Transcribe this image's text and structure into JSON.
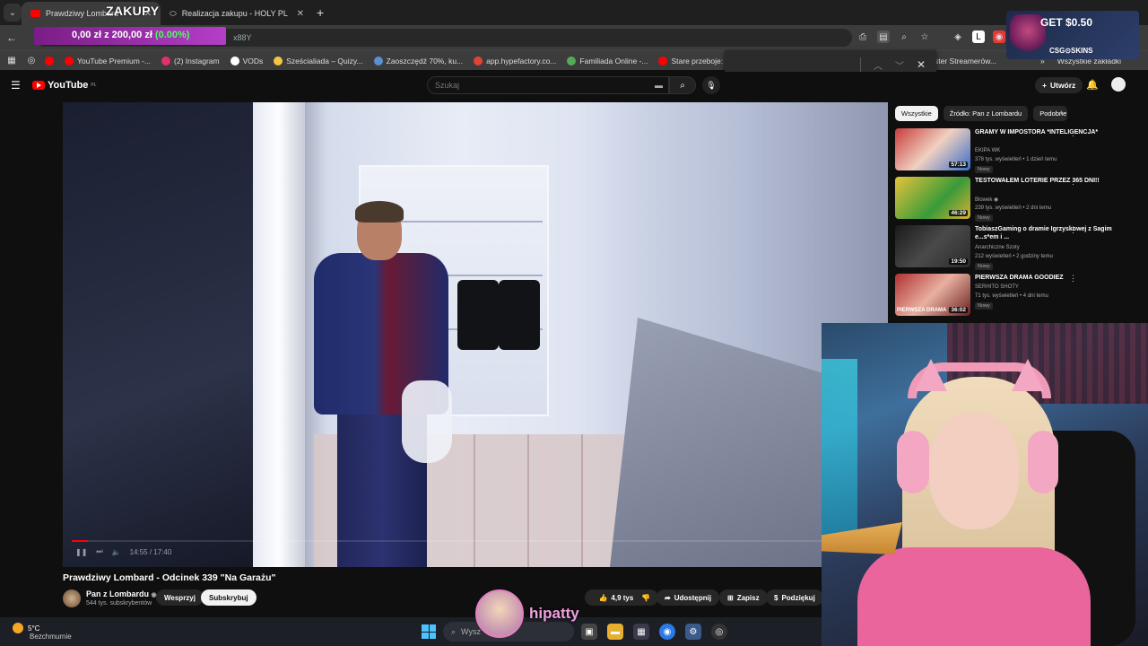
{
  "browser": {
    "tabs": [
      {
        "label": "Prawdziwy Lombard",
        "active": true
      },
      {
        "label": "Realizacja zakupu - HOLY PL",
        "active": false
      }
    ],
    "url_fragment": "x88Y",
    "bookmarks": [
      {
        "label": "YouTube Premium -...",
        "color": "#ff0000"
      },
      {
        "label": "(2) Instagram",
        "color": "#e1306c"
      },
      {
        "label": "VODs",
        "color": "#ffffff"
      },
      {
        "label": "Sześcialiada – Quizy...",
        "color": "#f5c542"
      },
      {
        "label": "Zaoszczędź 70%, ku...",
        "color": "#1b2838"
      },
      {
        "label": "app.hypefactory.co...",
        "color": "#e34234"
      },
      {
        "label": "Familiada Online -...",
        "color": "#55aa55"
      },
      {
        "label": "Stare przeboje: lege...",
        "color": "#ff0000"
      },
      {
        "label": "ster Streamerów...",
        "color": "#9146ff"
      },
      {
        "label": "Wszystkie zakładki",
        "color": "#888888"
      }
    ]
  },
  "overlay": {
    "zakupy_title": "ZAKUPY",
    "zakupy_amount": "0,00 zł z 200,00 zł",
    "zakupy_percent": "(0.00%)",
    "csgo_get": "GET $0.50",
    "csgo_brand": "CSG⊙SKINS",
    "streamer_name": "hipatty"
  },
  "youtube": {
    "logo": "YouTube",
    "region": "PL",
    "search_placeholder": "Szukaj",
    "create_label": "Utwórz",
    "video": {
      "title": "Prawdziwy Lombard - Odcinek 339 \"Na Garażu\"",
      "time": "14:55 / 17:40",
      "progress": 0.02
    },
    "channel": {
      "name": "Pan z Lombardu",
      "subscribers": "544 tys. subskrybentów",
      "support_label": "Wesprzyj",
      "subscribe_label": "Subskrybuj"
    },
    "actions": {
      "likes": "4,9 tys.",
      "share": "Udostępnij",
      "save": "Zapisz",
      "thanks": "Podziękuj"
    },
    "chips": [
      "Wszystkie",
      "Źródło: Pan z Lombardu",
      "Podobne"
    ],
    "recommendations": [
      {
        "title": "GRAMY W IMPOSTORA *INTELIGENCJA*",
        "channel": "EKIPA WK",
        "meta": "378 tys. wyświetleń • 1 dzień temu",
        "duration": "57:13",
        "badge": "Nowy",
        "thumb": "#c83c3c"
      },
      {
        "title": "TESTOWAŁEM LOTERIE PRZEZ 365 DNI!!",
        "channel": "Blowek",
        "meta": "239 tys. wyświetleń • 2 dni temu",
        "duration": "46:29",
        "badge": "Nowy",
        "thumb": "#d8b030"
      },
      {
        "title": "TobiaszGaming o dramie Igrzyskowej z Sagim e...s*em i ...",
        "channel": "Anarchiczne Szoty",
        "meta": "212 wyświetleń • 2 godziny temu",
        "duration": "19:50",
        "badge": "Nowy",
        "thumb": "#2a2a2a"
      },
      {
        "title": "PIERWSZA DRAMA GOODIEZ",
        "channel": "SERHITO SHOTY",
        "meta": "71 tys. wyświetleń • 4 dni temu",
        "duration": "36:02",
        "badge": "Nowy",
        "thumb": "#b03030"
      }
    ],
    "thumb_overlay_text": "PIERWSZA DRAMA"
  },
  "taskbar": {
    "temp": "5°C",
    "weather": "Bezchmurnie",
    "search": "Wysz"
  }
}
